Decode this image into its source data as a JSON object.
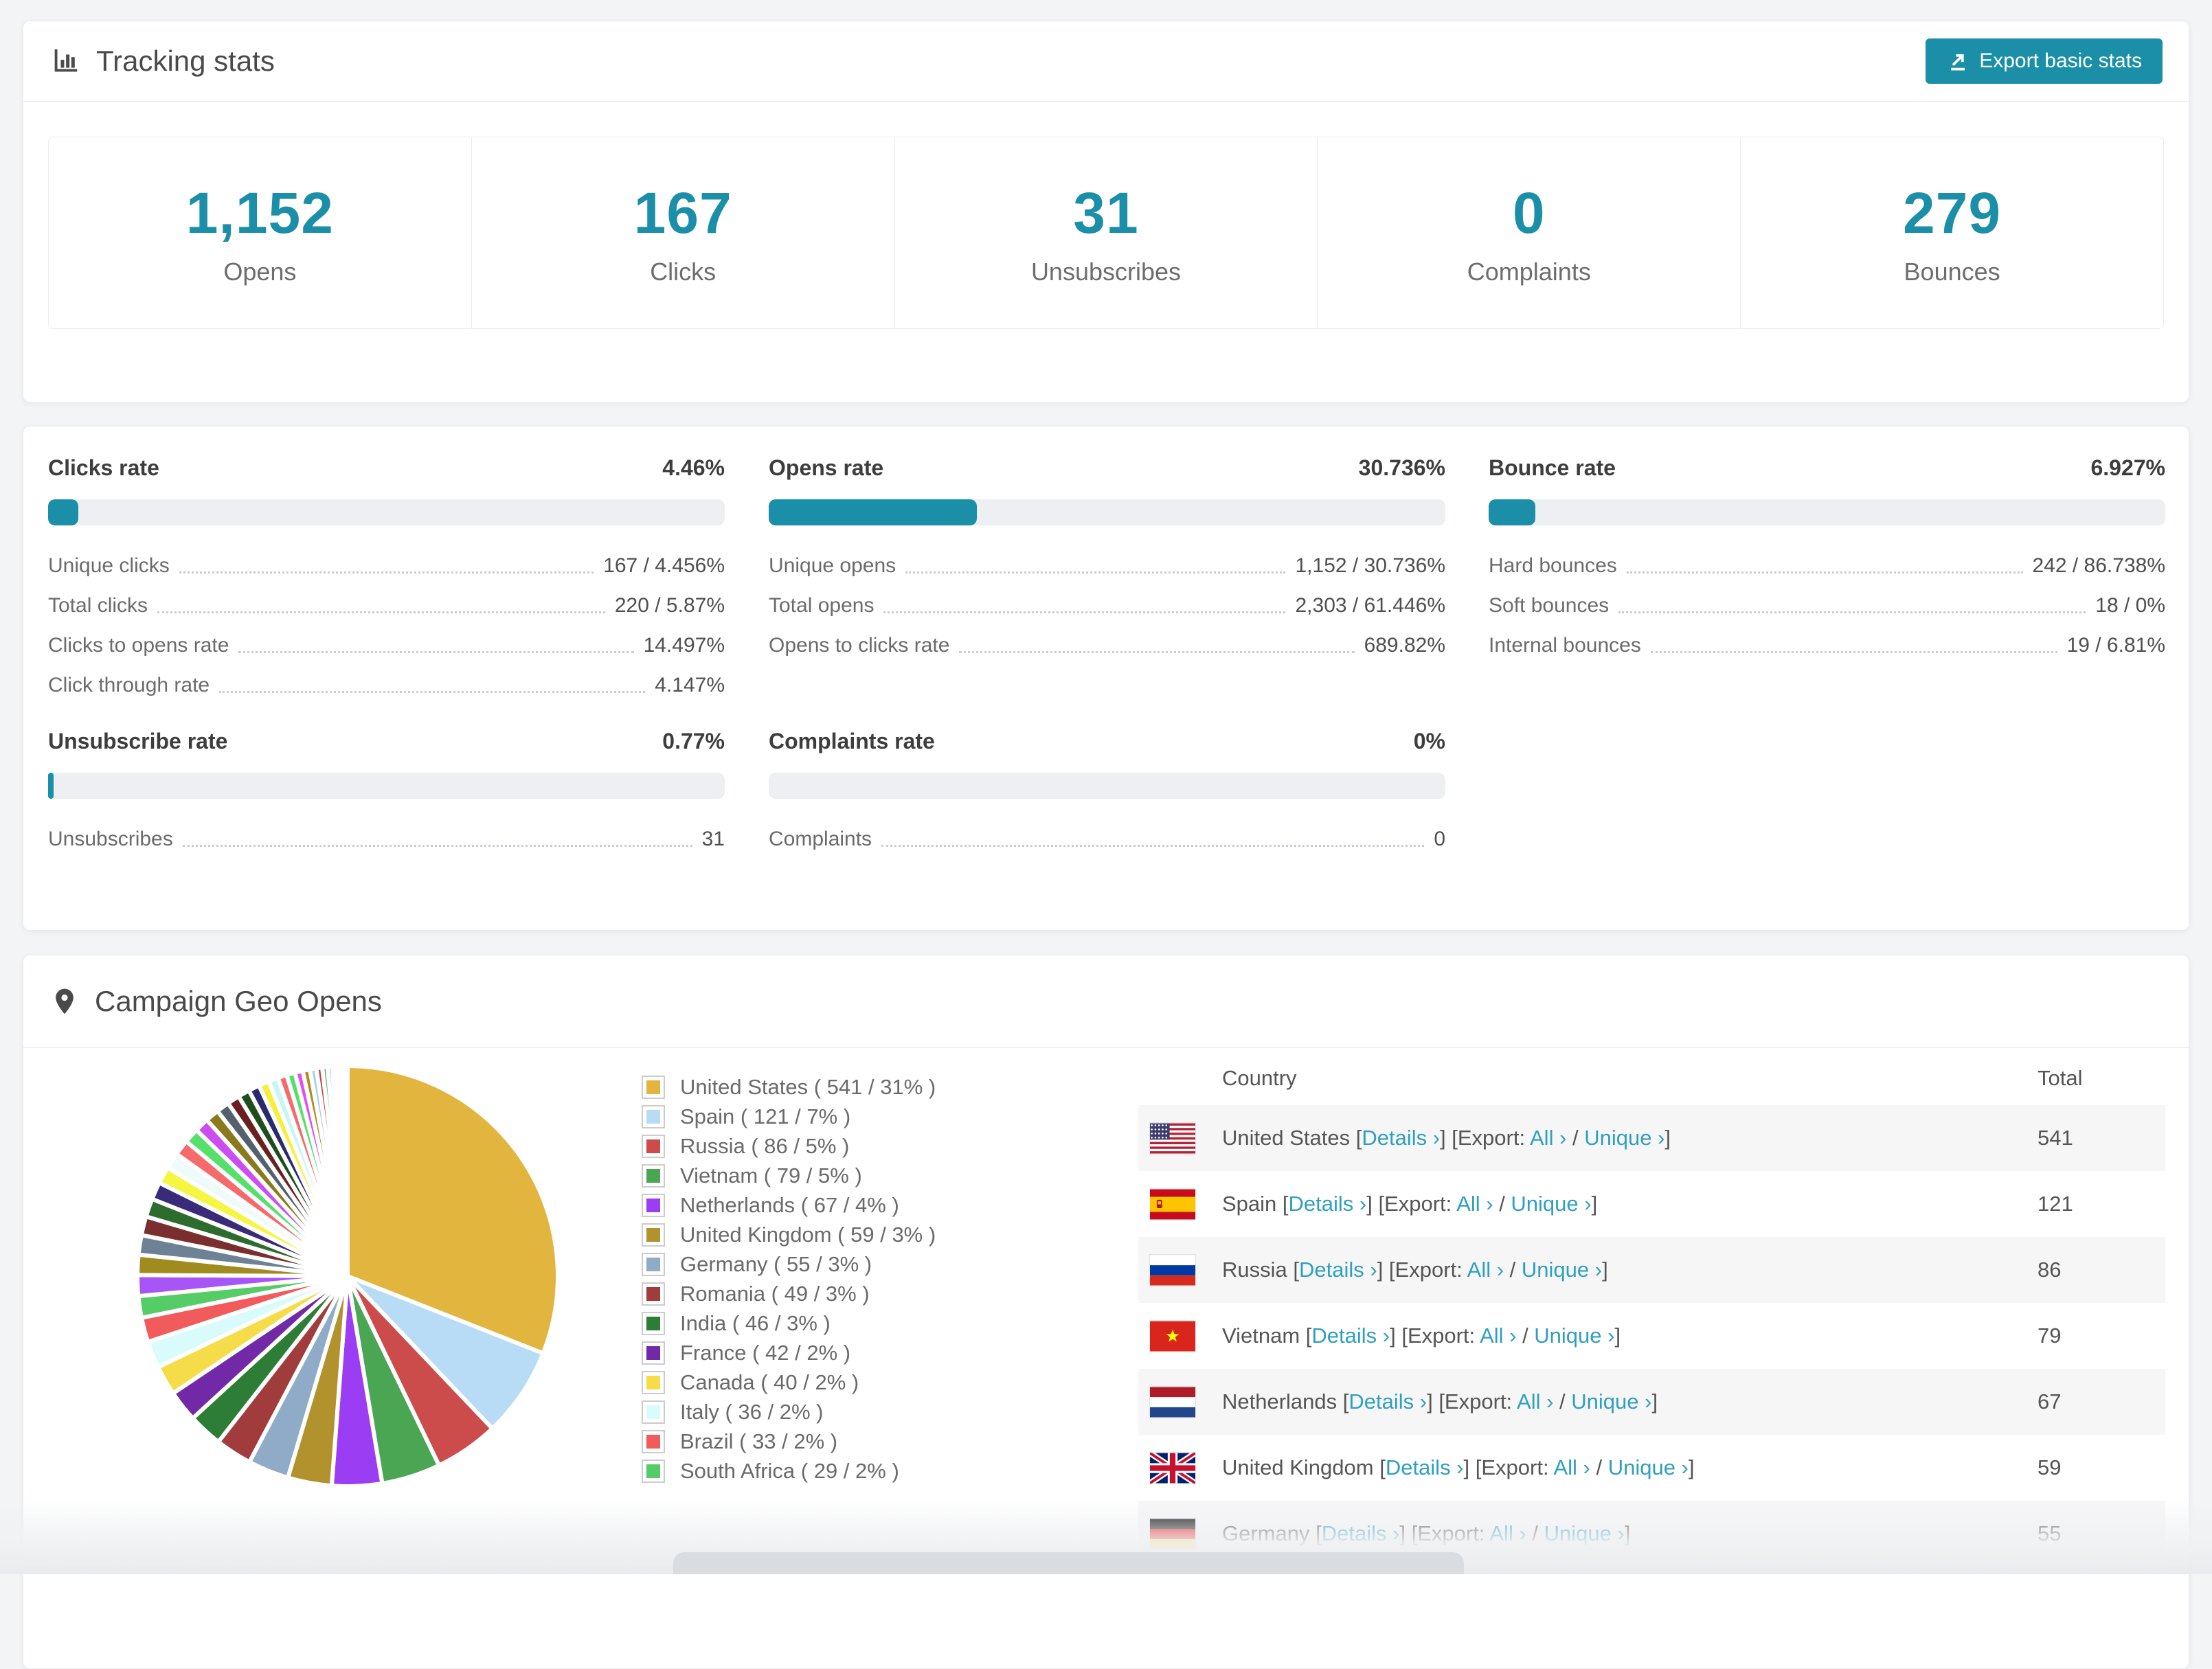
{
  "colors": {
    "accent": "#1b8fa8",
    "link": "#2f9fc0",
    "page_bg": "#f3f4f6"
  },
  "header": {
    "title": "Tracking stats",
    "export_label": "Export basic stats"
  },
  "summary": [
    {
      "value": "1,152",
      "label": "Opens"
    },
    {
      "value": "167",
      "label": "Clicks"
    },
    {
      "value": "31",
      "label": "Unsubscribes"
    },
    {
      "value": "0",
      "label": "Complaints"
    },
    {
      "value": "279",
      "label": "Bounces"
    }
  ],
  "rates": [
    {
      "title": "Clicks rate",
      "value": "4.46%",
      "percent": 4.46,
      "rows": [
        {
          "label": "Unique clicks",
          "value": "167 / 4.456%"
        },
        {
          "label": "Total clicks",
          "value": "220 / 5.87%"
        },
        {
          "label": "Clicks to opens rate",
          "value": "14.497%"
        },
        {
          "label": "Click through rate",
          "value": "4.147%"
        }
      ]
    },
    {
      "title": "Opens rate",
      "value": "30.736%",
      "percent": 30.736,
      "rows": [
        {
          "label": "Unique opens",
          "value": "1,152 / 30.736%"
        },
        {
          "label": "Total opens",
          "value": "2,303 / 61.446%"
        },
        {
          "label": "Opens to clicks rate",
          "value": "689.82%"
        }
      ]
    },
    {
      "title": "Bounce rate",
      "value": "6.927%",
      "percent": 6.927,
      "rows": [
        {
          "label": "Hard bounces",
          "value": "242 / 86.738%"
        },
        {
          "label": "Soft bounces",
          "value": "18 / 0%"
        },
        {
          "label": "Internal bounces",
          "value": "19 / 6.81%"
        }
      ]
    },
    {
      "title": "Unsubscribe rate",
      "value": "0.77%",
      "percent": 0.77,
      "rows": [
        {
          "label": "Unsubscribes",
          "value": "31"
        }
      ]
    },
    {
      "title": "Complaints rate",
      "value": "0%",
      "percent": 0,
      "rows": [
        {
          "label": "Complaints",
          "value": "0"
        }
      ]
    }
  ],
  "geo": {
    "title": "Campaign Geo Opens",
    "legend": [
      {
        "label": "United States ( 541 / 31% )",
        "color": "#e2b53e"
      },
      {
        "label": "Spain ( 121 / 7% )",
        "color": "#b8dcf5"
      },
      {
        "label": "Russia ( 86 / 5% )",
        "color": "#cc4c4c"
      },
      {
        "label": "Vietnam ( 79 / 5% )",
        "color": "#4ba654"
      },
      {
        "label": "Netherlands ( 67 / 4% )",
        "color": "#9b3df2"
      },
      {
        "label": "United Kingdom ( 59 / 3% )",
        "color": "#b2922c"
      },
      {
        "label": "Germany ( 55 / 3% )",
        "color": "#8fabc8"
      },
      {
        "label": "Romania ( 49 / 3% )",
        "color": "#a03c3c"
      },
      {
        "label": "India ( 46 / 3% )",
        "color": "#2e7d36"
      },
      {
        "label": "France ( 42 / 2% )",
        "color": "#7229a8"
      },
      {
        "label": "Canada ( 40 / 2% )",
        "color": "#f5dd4a"
      },
      {
        "label": "Italy ( 36 / 2% )",
        "color": "#d9fbfb"
      },
      {
        "label": "Brazil ( 33 / 2% )",
        "color": "#f15b5b"
      },
      {
        "label": "South Africa ( 29 / 2% )",
        "color": "#55cc66"
      }
    ],
    "chart_data": {
      "type": "pie",
      "title": "Campaign Geo Opens",
      "unit": "opens",
      "legend_position": "right",
      "slices": [
        {
          "label": "United States",
          "value": 541,
          "percent_label": "31%",
          "draw": 31.0,
          "color": "#e2b53e"
        },
        {
          "label": "Spain",
          "value": 121,
          "percent_label": "7%",
          "draw": 6.93,
          "color": "#b8dcf5"
        },
        {
          "label": "Russia",
          "value": 86,
          "percent_label": "5%",
          "draw": 4.93,
          "color": "#cc4c4c"
        },
        {
          "label": "Vietnam",
          "value": 79,
          "percent_label": "5%",
          "draw": 4.53,
          "color": "#4ba654"
        },
        {
          "label": "Netherlands",
          "value": 67,
          "percent_label": "4%",
          "draw": 3.84,
          "color": "#9b3df2"
        },
        {
          "label": "United Kingdom",
          "value": 59,
          "percent_label": "3%",
          "draw": 3.38,
          "color": "#b2922c"
        },
        {
          "label": "Germany",
          "value": 55,
          "percent_label": "3%",
          "draw": 3.15,
          "color": "#8fabc8"
        },
        {
          "label": "Romania",
          "value": 49,
          "percent_label": "3%",
          "draw": 2.81,
          "color": "#a03c3c"
        },
        {
          "label": "India",
          "value": 46,
          "percent_label": "3%",
          "draw": 2.64,
          "color": "#2e7d36"
        },
        {
          "label": "France",
          "value": 42,
          "percent_label": "2%",
          "draw": 2.41,
          "color": "#7229a8"
        },
        {
          "label": "Canada",
          "value": 40,
          "percent_label": "2%",
          "draw": 2.29,
          "color": "#f5dd4a"
        },
        {
          "label": "Italy",
          "value": 36,
          "percent_label": "2%",
          "draw": 2.06,
          "color": "#d9fbfb"
        },
        {
          "label": "Brazil",
          "value": 33,
          "percent_label": "2%",
          "draw": 1.89,
          "color": "#f15b5b"
        },
        {
          "label": "South Africa",
          "value": 29,
          "percent_label": "2%",
          "draw": 1.66,
          "color": "#55cc66"
        }
      ],
      "other_slices": [
        {
          "percent": 1.6,
          "color": "#a855f7"
        },
        {
          "percent": 1.55,
          "color": "#a08b1e"
        },
        {
          "percent": 1.5,
          "color": "#6e8296"
        },
        {
          "percent": 1.45,
          "color": "#7a2e2e"
        },
        {
          "percent": 1.4,
          "color": "#2e6b2e"
        },
        {
          "percent": 1.35,
          "color": "#3a2a7a"
        },
        {
          "percent": 1.3,
          "color": "#f5f542"
        },
        {
          "percent": 1.25,
          "color": "#effbfb"
        },
        {
          "percent": 1.2,
          "color": "#f56b6b"
        },
        {
          "percent": 1.15,
          "color": "#55e06b"
        },
        {
          "percent": 1.1,
          "color": "#cc4df2"
        },
        {
          "percent": 1.05,
          "color": "#8a7a1e"
        },
        {
          "percent": 1.0,
          "color": "#55606e"
        },
        {
          "percent": 0.95,
          "color": "#6b1f1f"
        },
        {
          "percent": 0.9,
          "color": "#1e4d1e"
        },
        {
          "percent": 0.85,
          "color": "#2a2a6e"
        },
        {
          "percent": 0.8,
          "color": "#f7ef3c"
        },
        {
          "percent": 0.75,
          "color": "#c8f5f5"
        },
        {
          "percent": 0.7,
          "color": "#f56b6b"
        },
        {
          "percent": 0.65,
          "color": "#55e06b"
        },
        {
          "percent": 0.6,
          "color": "#e04df2"
        },
        {
          "percent": 0.55,
          "color": "#b08b20"
        },
        {
          "percent": 0.5,
          "color": "#a8d0f0"
        },
        {
          "percent": 0.45,
          "color": "#d23c3c"
        },
        {
          "percent": 0.4,
          "color": "#3cb84c"
        },
        {
          "percent": 0.35,
          "color": "#8c3cf0"
        },
        {
          "percent": 0.3,
          "color": "#caa428"
        },
        {
          "percent": 0.25,
          "color": "#a8d8f0"
        },
        {
          "percent": 0.2,
          "color": "#e05050"
        },
        {
          "percent": 0.15,
          "color": "#52c86a"
        },
        {
          "percent": 0.1,
          "color": "#b03df0"
        },
        {
          "percent": 0.08,
          "color": "#caa428"
        },
        {
          "percent": 0.06,
          "color": "#80b8e8"
        },
        {
          "percent": 0.04,
          "color": "#d23c3c"
        }
      ]
    },
    "table": {
      "headers": [
        "Country",
        "Total"
      ],
      "row_format": {
        "open": "[",
        "close": "]",
        "details_label": "Details",
        "export_label": "Export:",
        "all_label": "All",
        "unique_label": "Unique",
        "chevron": "›",
        "separator": "/"
      },
      "rows": [
        {
          "country": "United States",
          "flag": "us",
          "total": "541"
        },
        {
          "country": "Spain",
          "flag": "es",
          "total": "121"
        },
        {
          "country": "Russia",
          "flag": "ru",
          "total": "86"
        },
        {
          "country": "Vietnam",
          "flag": "vn",
          "total": "79"
        },
        {
          "country": "Netherlands",
          "flag": "nl",
          "total": "67"
        },
        {
          "country": "United Kingdom",
          "flag": "gb",
          "total": "59"
        },
        {
          "country": "Germany",
          "flag": "de",
          "total": "55"
        }
      ]
    }
  }
}
